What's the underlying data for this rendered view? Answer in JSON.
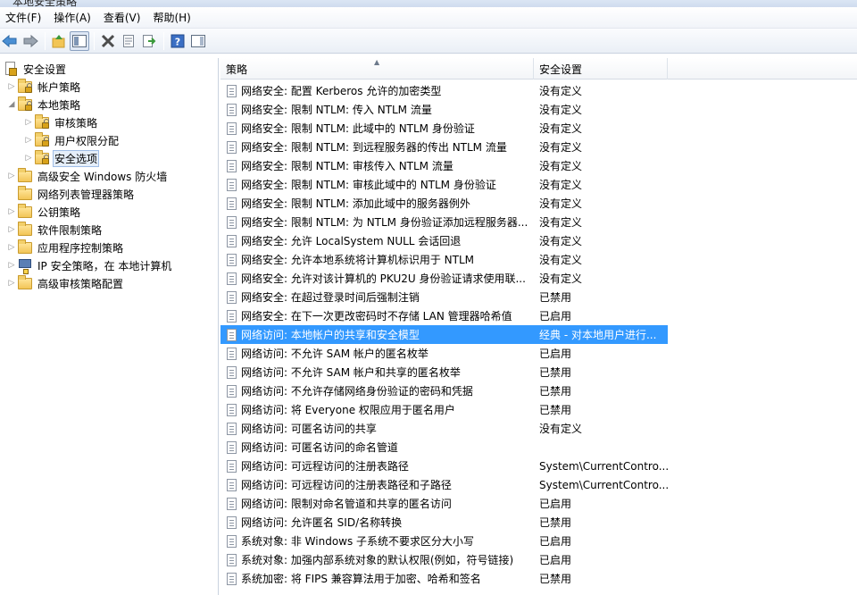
{
  "window": {
    "title": "本地安全策略"
  },
  "menu": [
    "文件(F)",
    "操作(A)",
    "查看(V)",
    "帮助(H)"
  ],
  "toolbar": {
    "icons": [
      "back-icon",
      "forward-icon",
      "up-icon",
      "show-hide-tree-icon",
      "delete-icon",
      "properties-icon",
      "export-icon",
      "help-icon",
      "action-pane-icon"
    ]
  },
  "tree": {
    "root": "安全设置",
    "items": [
      {
        "label": "帐户策略"
      },
      {
        "label": "本地策略"
      },
      {
        "label": "审核策略"
      },
      {
        "label": "用户权限分配"
      },
      {
        "label": "安全选项"
      },
      {
        "label": "高级安全 Windows 防火墙"
      },
      {
        "label": "网络列表管理器策略"
      },
      {
        "label": "公钥策略"
      },
      {
        "label": "软件限制策略"
      },
      {
        "label": "应用程序控制策略"
      },
      {
        "label": "IP 安全策略，在 本地计算机"
      },
      {
        "label": "高级审核策略配置"
      }
    ]
  },
  "list": {
    "columns": {
      "policy": "策略",
      "setting": "安全设置"
    },
    "rows": [
      {
        "policy": "网络安全: 配置 Kerberos 允许的加密类型",
        "setting": "没有定义"
      },
      {
        "policy": "网络安全: 限制 NTLM: 传入 NTLM 流量",
        "setting": "没有定义"
      },
      {
        "policy": "网络安全: 限制 NTLM: 此域中的 NTLM 身份验证",
        "setting": "没有定义"
      },
      {
        "policy": "网络安全: 限制 NTLM: 到远程服务器的传出 NTLM 流量",
        "setting": "没有定义"
      },
      {
        "policy": "网络安全: 限制 NTLM: 审核传入 NTLM 流量",
        "setting": "没有定义"
      },
      {
        "policy": "网络安全: 限制 NTLM: 审核此域中的 NTLM 身份验证",
        "setting": "没有定义"
      },
      {
        "policy": "网络安全: 限制 NTLM: 添加此域中的服务器例外",
        "setting": "没有定义"
      },
      {
        "policy": "网络安全: 限制 NTLM: 为 NTLM 身份验证添加远程服务器...",
        "setting": "没有定义"
      },
      {
        "policy": "网络安全: 允许 LocalSystem NULL 会话回退",
        "setting": "没有定义"
      },
      {
        "policy": "网络安全: 允许本地系统将计算机标识用于 NTLM",
        "setting": "没有定义"
      },
      {
        "policy": "网络安全: 允许对该计算机的 PKU2U 身份验证请求使用联...",
        "setting": "没有定义"
      },
      {
        "policy": "网络安全: 在超过登录时间后强制注销",
        "setting": "已禁用"
      },
      {
        "policy": "网络安全: 在下一次更改密码时不存储 LAN 管理器哈希值",
        "setting": "已启用"
      },
      {
        "policy": "网络访问: 本地帐户的共享和安全模型",
        "setting": "经典 - 对本地用户进行..."
      },
      {
        "policy": "网络访问: 不允许 SAM 帐户的匿名枚举",
        "setting": "已启用"
      },
      {
        "policy": "网络访问: 不允许 SAM 帐户和共享的匿名枚举",
        "setting": "已禁用"
      },
      {
        "policy": "网络访问: 不允许存储网络身份验证的密码和凭据",
        "setting": "已禁用"
      },
      {
        "policy": "网络访问: 将 Everyone 权限应用于匿名用户",
        "setting": "已禁用"
      },
      {
        "policy": "网络访问: 可匿名访问的共享",
        "setting": "没有定义"
      },
      {
        "policy": "网络访问: 可匿名访问的命名管道",
        "setting": ""
      },
      {
        "policy": "网络访问: 可远程访问的注册表路径",
        "setting": "System\\CurrentContro..."
      },
      {
        "policy": "网络访问: 可远程访问的注册表路径和子路径",
        "setting": "System\\CurrentContro..."
      },
      {
        "policy": "网络访问: 限制对命名管道和共享的匿名访问",
        "setting": "已启用"
      },
      {
        "policy": "网络访问: 允许匿名 SID/名称转换",
        "setting": "已禁用"
      },
      {
        "policy": "系统对象: 非 Windows 子系统不要求区分大小写",
        "setting": "已启用"
      },
      {
        "policy": "系统对象: 加强内部系统对象的默认权限(例如，符号链接)",
        "setting": "已启用"
      },
      {
        "policy": "系统加密: 将 FIPS 兼容算法用于加密、哈希和签名",
        "setting": "已禁用"
      }
    ]
  },
  "colors": {
    "selection": "#3399ff",
    "tree_selection": "#e5eef9"
  }
}
